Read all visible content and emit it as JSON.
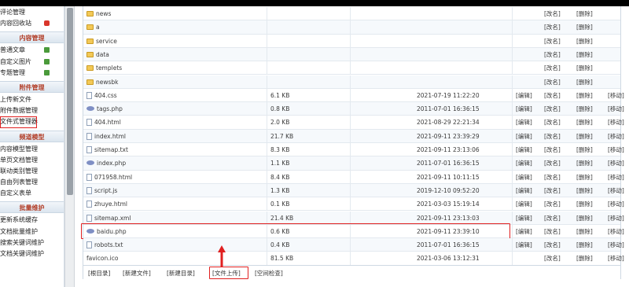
{
  "sidebar": {
    "items_top": [
      {
        "label": "评论管理",
        "icon": ""
      },
      {
        "label": "内容回收站",
        "icon": "red"
      }
    ],
    "groups": [
      {
        "title": "内容管理",
        "items": [
          {
            "label": "普通文章",
            "icon": "plus"
          },
          {
            "label": "自定义图片",
            "icon": "plus"
          },
          {
            "label": "专题管理",
            "icon": "plus"
          }
        ]
      },
      {
        "title": "附件管理",
        "items": [
          {
            "label": "上传新文件",
            "icon": ""
          },
          {
            "label": "附件数据管理",
            "icon": ""
          },
          {
            "label": "文件式管理器",
            "icon": "",
            "highlight": true
          }
        ]
      },
      {
        "title": "频道模型",
        "items": [
          {
            "label": "内容模型管理",
            "icon": ""
          },
          {
            "label": "单页文档管理",
            "icon": ""
          },
          {
            "label": "联动类别管理",
            "icon": ""
          },
          {
            "label": "自由列表管理",
            "icon": ""
          },
          {
            "label": "自定义表单",
            "icon": ""
          }
        ]
      },
      {
        "title": "批量维护",
        "items": [
          {
            "label": "更新系统缓存",
            "icon": ""
          },
          {
            "label": "文档批量维护",
            "icon": ""
          },
          {
            "label": "搜索关键词维护",
            "icon": ""
          },
          {
            "label": "文档关键词维护",
            "icon": ""
          }
        ]
      }
    ]
  },
  "files": {
    "dirs": [
      {
        "name": "news",
        "actions": [
          "[改名]",
          "[删除]"
        ]
      },
      {
        "name": "a",
        "actions": [
          "[改名]",
          "[删除]"
        ]
      },
      {
        "name": "service",
        "actions": [
          "[改名]",
          "[删除]"
        ]
      },
      {
        "name": "data",
        "actions": [
          "[改名]",
          "[删除]"
        ]
      },
      {
        "name": "templets",
        "actions": [
          "[改名]",
          "[删除]"
        ]
      },
      {
        "name": "newsbk",
        "actions": [
          "[改名]",
          "[删除]"
        ]
      }
    ],
    "rows": [
      {
        "name": "404.css",
        "type": "file",
        "size": "6.1 KB",
        "time": "2021-07-19 11:22:20",
        "actions": [
          "[编辑]",
          "[改名]",
          "[删除]",
          "[移动]"
        ]
      },
      {
        "name": "tags.php",
        "type": "php",
        "size": "0.8 KB",
        "time": "2011-07-01 16:36:15",
        "actions": [
          "[编辑]",
          "[改名]",
          "[删除]",
          "[移动]"
        ]
      },
      {
        "name": "404.html",
        "type": "file",
        "size": "2.0 KB",
        "time": "2021-08-29 22:21:34",
        "actions": [
          "[编辑]",
          "[改名]",
          "[删除]",
          "[移动]"
        ]
      },
      {
        "name": "index.html",
        "type": "file",
        "size": "21.7 KB",
        "time": "2021-09-11 23:39:29",
        "actions": [
          "[编辑]",
          "[改名]",
          "[删除]",
          "[移动]"
        ]
      },
      {
        "name": "sitemap.txt",
        "type": "file",
        "size": "8.3 KB",
        "time": "2021-09-11 23:13:06",
        "actions": [
          "[编辑]",
          "[改名]",
          "[删除]",
          "[移动]"
        ]
      },
      {
        "name": "index.php",
        "type": "php",
        "size": "1.1 KB",
        "time": "2011-07-01 16:36:15",
        "actions": [
          "[编辑]",
          "[改名]",
          "[删除]",
          "[移动]"
        ]
      },
      {
        "name": "071958.html",
        "type": "file",
        "size": "8.4 KB",
        "time": "2021-09-11 10:11:15",
        "actions": [
          "[编辑]",
          "[改名]",
          "[删除]",
          "[移动]"
        ]
      },
      {
        "name": "script.js",
        "type": "file",
        "size": "1.3 KB",
        "time": "2019-12-10 09:52:20",
        "actions": [
          "[编辑]",
          "[改名]",
          "[删除]",
          "[移动]"
        ]
      },
      {
        "name": "zhuye.html",
        "type": "file",
        "size": "0.1 KB",
        "time": "2021-03-03 15:19:14",
        "actions": [
          "[编辑]",
          "[改名]",
          "[删除]",
          "[移动]"
        ]
      },
      {
        "name": "sitemap.xml",
        "type": "file",
        "size": "21.4 KB",
        "time": "2021-09-11 23:13:03",
        "actions": [
          "[编辑]",
          "[改名]",
          "[删除]",
          "[移动]"
        ]
      },
      {
        "name": "baidu.php",
        "type": "php",
        "size": "0.6 KB",
        "time": "2021-09-11 23:39:10",
        "actions": [
          "[编辑]",
          "[改名]",
          "[删除]",
          "[移动]"
        ],
        "highlight": true
      },
      {
        "name": "robots.txt",
        "type": "file",
        "size": "0.4 KB",
        "time": "2011-07-01 16:36:15",
        "actions": [
          "[编辑]",
          "[改名]",
          "[删除]",
          "[移动]"
        ]
      },
      {
        "name": "favicon.ico",
        "type": "none",
        "size": "81.5 KB",
        "time": "2021-03-06 13:12:31",
        "actions": [
          "[改名]",
          "[删除]",
          "[移动]"
        ]
      }
    ]
  },
  "toolbar": {
    "root": "[根目录]",
    "new_file": "[新建文件]",
    "new_dir": "[新建目录]",
    "upload": "[文件上传]",
    "space_check": "[空间检查]"
  },
  "colors": {
    "highlight": "#e02020",
    "group_title": "#b3402a",
    "folder": "#f3c957"
  }
}
